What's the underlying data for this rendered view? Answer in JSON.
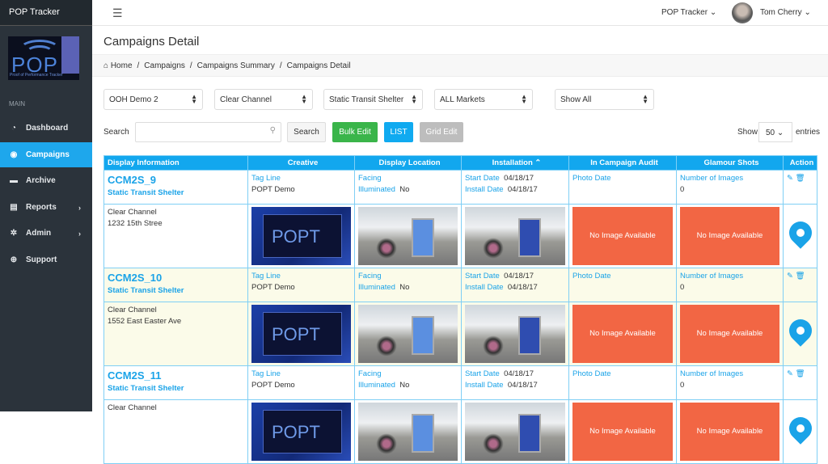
{
  "app_title": "POP Tracker",
  "logo_text": "POPT",
  "logo_sub": "Proof of Performance Tracker",
  "sidebar": {
    "section": "MAIN",
    "items": [
      {
        "label": "Dashboard",
        "icon": "dashboard-icon",
        "glyph": "◔"
      },
      {
        "label": "Campaigns",
        "icon": "circle-icon",
        "glyph": "◉",
        "active": true
      },
      {
        "label": "Archive",
        "icon": "archive-icon",
        "glyph": "▬"
      },
      {
        "label": "Reports",
        "icon": "file-icon",
        "glyph": "▤",
        "chevron": "›"
      },
      {
        "label": "Admin",
        "icon": "gear-icon",
        "glyph": "✲",
        "chevron": "›"
      },
      {
        "label": "Support",
        "icon": "support-icon",
        "glyph": "⊕"
      }
    ]
  },
  "topbar": {
    "app_menu": "POP Tracker ⌄",
    "user": "Tom Cherry ⌄"
  },
  "page_title": "Campaigns Detail",
  "breadcrumb": [
    "Home",
    "Campaigns",
    "Campaigns Summary",
    "Campaigns Detail"
  ],
  "filters": [
    "OOH Demo 2",
    "Clear Channel",
    "Static Transit Shelter",
    "ALL Markets",
    "Show All"
  ],
  "search": {
    "label": "Search",
    "value": "",
    "button": "Search"
  },
  "buttons": {
    "bulk": "Bulk Edit",
    "list": "LIST",
    "grid": "Grid Edit"
  },
  "entries": {
    "show": "Show",
    "value": "50",
    "suffix": "entries"
  },
  "table": {
    "headers": [
      "Display Information",
      "Creative",
      "Display Location",
      "Installation ⌃",
      "In Campaign Audit",
      "Glamour Shots",
      "Action"
    ],
    "labels": {
      "tag": "Tag Line",
      "facing": "Facing",
      "illuminated": "Illuminated",
      "start": "Start Date",
      "install": "Install Date",
      "photo": "Photo Date",
      "num": "Number of Images",
      "noimg": "No Image Available"
    },
    "rows": [
      {
        "id": "CCM2S_9",
        "type": "Static Transit Shelter",
        "vendor": "Clear Channel",
        "address": "1232 15th Stree",
        "tag": "POPT Demo",
        "illuminated": "No",
        "start": "04/18/17",
        "install": "04/18/17",
        "images": "0"
      },
      {
        "id": "CCM2S_10",
        "type": "Static Transit Shelter",
        "vendor": "Clear Channel",
        "address": "1552 East Easter Ave",
        "tag": "POPT Demo",
        "illuminated": "No",
        "start": "04/18/17",
        "install": "04/18/17",
        "images": "0"
      },
      {
        "id": "CCM2S_11",
        "type": "Static Transit Shelter",
        "vendor": "Clear Channel",
        "address": "",
        "tag": "POPT Demo",
        "illuminated": "No",
        "start": "04/18/17",
        "install": "04/18/17",
        "images": "0"
      }
    ]
  }
}
